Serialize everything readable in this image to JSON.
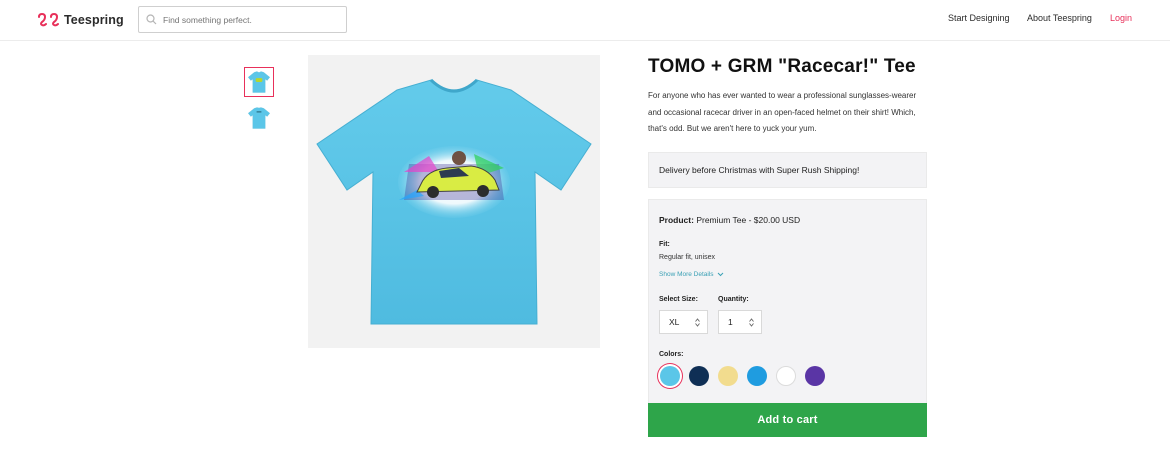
{
  "header": {
    "logo_text": "Teespring",
    "search_placeholder": "Find something perfect.",
    "nav": {
      "start_designing": "Start Designing",
      "about": "About Teespring",
      "login": "Login"
    }
  },
  "gallery": {
    "thumbnails": [
      "front-view",
      "back-view"
    ],
    "main_image": "t-shirt-with-car-graphic"
  },
  "product": {
    "title": "TOMO + GRM \"Racecar!\" Tee",
    "description": "For anyone who has ever wanted to wear a professional sunglasses-wearer and occasional racecar driver in an open-faced helmet on their shirt! Which, that's odd. But we aren't here to yuck your yum.",
    "delivery_notice": "Delivery before Christmas with Super Rush Shipping!",
    "product_label": "Product:",
    "product_value": "Premium Tee - $20.00 USD",
    "fit_label": "Fit:",
    "fit_value": "Regular fit, unisex",
    "show_more": "Show More Details",
    "size_label": "Select Size:",
    "size_value": "XL",
    "quantity_label": "Quantity:",
    "quantity_value": "1",
    "colors_label": "Colors:",
    "colors": [
      "#5bc6e8",
      "#0f2f55",
      "#f2dc8e",
      "#1f9ce0",
      "#ffffff",
      "#5a35a5"
    ],
    "selected_color_index": 0,
    "add_to_cart": "Add to cart"
  },
  "theme": {
    "accent": "#e8305a",
    "cta": "#2ea54a",
    "shirt": "#5bc6e8"
  }
}
